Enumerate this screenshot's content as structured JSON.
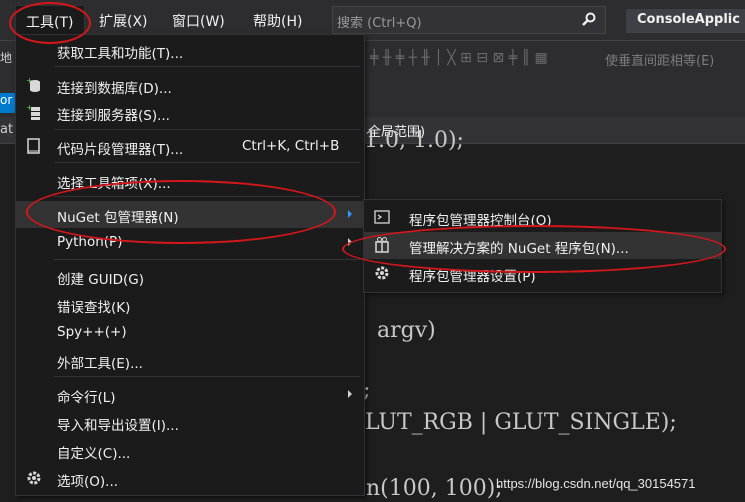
{
  "menubar": {
    "tools": "工具(T)",
    "extensions": "扩展(X)",
    "window": "窗口(W)",
    "help": "帮助(H)",
    "search_placeholder": "搜索 (Ctrl+Q)",
    "project_title": "ConsoleApplic"
  },
  "toolbar": {
    "tail_text": "使垂直间距相等(E)"
  },
  "navbar": {
    "scope": "全局范围)"
  },
  "left_fragments": [
    "地",
    "or",
    "at"
  ],
  "tools_menu": {
    "items": [
      {
        "label": "获取工具和功能(T)..."
      },
      {
        "label": "连接到数据库(D)...",
        "icon": "database-icon"
      },
      {
        "label": "连接到服务器(S)...",
        "icon": "server-icon"
      },
      {
        "label": "代码片段管理器(T)...",
        "shortcut": "Ctrl+K, Ctrl+B",
        "icon": "snippet-icon"
      },
      {
        "label": "选择工具箱项(X)..."
      },
      {
        "label": "NuGet 包管理器(N)"
      },
      {
        "label": "Python(P)"
      },
      {
        "label": "创建 GUID(G)"
      },
      {
        "label": "错误查找(K)"
      },
      {
        "label": "Spy++(+)"
      },
      {
        "label": "外部工具(E)..."
      },
      {
        "label": "命令行(L)"
      },
      {
        "label": "导入和导出设置(I)..."
      },
      {
        "label": "自定义(C)..."
      },
      {
        "label": "选项(O)...",
        "icon": "gear-icon"
      }
    ]
  },
  "nuget_submenu": {
    "items": [
      {
        "label": "程序包管理器控制台(O)",
        "icon": "console-icon"
      },
      {
        "label": "管理解决方案的 NuGet 程序包(N)...",
        "icon": "package-icon"
      },
      {
        "label": "程序包管理器设置(P)",
        "icon": "gear-icon"
      }
    ]
  },
  "code": {
    "line1": ", 1.0, 1.0);",
    "line2": "argv)",
    "line3": ";",
    "line4": "LUT_RGB | GLUT_SINGLE);",
    "line5": "n(100, 100);"
  },
  "watermark": "https://blog.csdn.net/qq_30154571",
  "colors": {
    "annotation": "#d3171a",
    "accent": "#007acc",
    "menu_bg": "#1b1b1c",
    "highlight": "#333334"
  }
}
